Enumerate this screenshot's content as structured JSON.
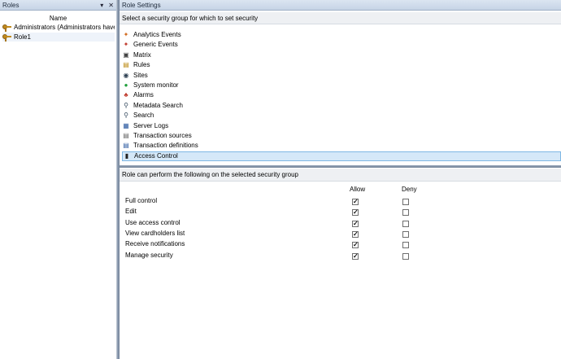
{
  "left_pane": {
    "title": "Roles",
    "header_buttons": [
      "▾",
      "✕"
    ],
    "column_header": "Name",
    "roles": [
      {
        "label": "Administrators (Administrators have co",
        "selected": false
      },
      {
        "label": "Role1",
        "selected": true
      }
    ]
  },
  "right_pane": {
    "title": "Role Settings",
    "groups_prompt": "Select a security group for which to set security",
    "groups": [
      {
        "label": "Analytics Events",
        "icon": "analytics-events-icon"
      },
      {
        "label": "Generic Events",
        "icon": "generic-events-icon"
      },
      {
        "label": "Matrix",
        "icon": "matrix-icon"
      },
      {
        "label": "Rules",
        "icon": "rules-icon"
      },
      {
        "label": "Sites",
        "icon": "sites-icon"
      },
      {
        "label": "System monitor",
        "icon": "system-monitor-icon"
      },
      {
        "label": "Alarms",
        "icon": "alarms-icon"
      },
      {
        "label": "Metadata Search",
        "icon": "metadata-search-icon"
      },
      {
        "label": "Search",
        "icon": "search-icon"
      },
      {
        "label": "Server Logs",
        "icon": "server-logs-icon"
      },
      {
        "label": "Transaction sources",
        "icon": "transaction-sources-icon"
      },
      {
        "label": "Transaction definitions",
        "icon": "transaction-definitions-icon"
      },
      {
        "label": "Access Control",
        "icon": "access-control-icon",
        "selected": true
      }
    ],
    "permissions_prompt": "Role can perform the following on the selected security group",
    "columns": {
      "allow": "Allow",
      "deny": "Deny"
    },
    "permissions": [
      {
        "label": "Full control",
        "allow": true,
        "deny": false
      },
      {
        "label": "Edit",
        "allow": true,
        "deny": false
      },
      {
        "label": "Use access control",
        "allow": true,
        "deny": false
      },
      {
        "label": "View cardholders list",
        "allow": true,
        "deny": false
      },
      {
        "label": "Receive notifications",
        "allow": true,
        "deny": false
      },
      {
        "label": "Manage security",
        "allow": true,
        "deny": false
      }
    ]
  },
  "colors": {
    "header_bg": "#c6d4e6",
    "selection_bg": "#d5e8f8",
    "selection_border": "#7fb7e4",
    "splitter": "#6f7f96"
  }
}
